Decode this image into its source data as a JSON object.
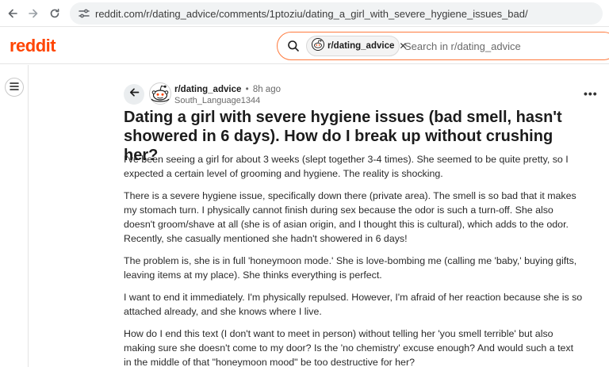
{
  "browser": {
    "url": "reddit.com/r/dating_advice/comments/1ptoziu/dating_a_girl_with_severe_hygiene_issues_bad/",
    "icons": [
      "back-arrow-icon",
      "forward-arrow-icon",
      "reload-icon",
      "site-settings-icon"
    ]
  },
  "header": {
    "logo": "reddit",
    "search": {
      "chip_label": "r/dating_advice",
      "chip_close": "✕",
      "placeholder": "Search in r/dating_advice"
    }
  },
  "post": {
    "subreddit": "r/dating_advice",
    "separator": "•",
    "time": "8h ago",
    "author": "South_Language1344",
    "more": "•••",
    "title": "Dating a girl with severe hygiene issues (bad smell, hasn't showered in 6 days). How do I break up without crushing her?",
    "paragraphs": [
      "I've been seeing a girl for about 3 weeks (slept together 3-4 times). She seemed to be quite pretty, so I expected a certain level of grooming and hygiene. The reality is shocking.",
      "There is a severe hygiene issue, specifically down there (private area). The smell is so bad that it makes my stomach turn. I physically cannot finish during sex because the odor is such a turn-off. She also doesn't groom/shave at all (she is of asian origin, and I thought this is cultural), which adds to the odor. Recently, she casually mentioned she hadn't showered in 6 days!",
      "The problem is, she is in full 'honeymoon mode.' She is love-bombing me (calling me 'baby,' buying gifts, leaving items at my place). She thinks everything is perfect.",
      "I want to end it immediately. I'm physically repulsed. However, I'm afraid of her reaction because she is so attached already, and she knows where I live.",
      "How do I end this text (I don't want to meet in person) without telling her 'you smell terrible' but also making sure she doesn't come to my door? Is the 'no chemistry' excuse enough? And would such a text in the middle of that \"honeymoon mood\" be too destructive for her?"
    ]
  },
  "colors": {
    "brand": "#ff4500",
    "search_border": "#ff7a3d",
    "text": "#1c1c1c",
    "muted": "#6a6a6a"
  }
}
